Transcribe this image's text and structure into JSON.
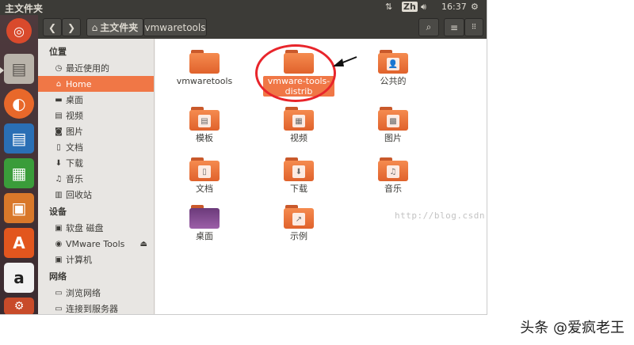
{
  "window_title": "主文件夹",
  "top_panel": {
    "ime": "Zh",
    "time": "16:37"
  },
  "toolbar": {
    "home_crumb": "主文件夹",
    "crumb_2": "vmwaretools"
  },
  "sidebar": {
    "places_header": "位置",
    "places": [
      {
        "label": "最近使用的",
        "icon": "clock-icon",
        "glyph": "◷"
      },
      {
        "label": "Home",
        "icon": "home-icon",
        "glyph": "⌂",
        "active": true
      },
      {
        "label": "桌面",
        "icon": "desktop-icon",
        "glyph": "▬"
      },
      {
        "label": "视频",
        "icon": "video-icon",
        "glyph": "▤"
      },
      {
        "label": "图片",
        "icon": "camera-icon",
        "glyph": "◙"
      },
      {
        "label": "文档",
        "icon": "document-icon",
        "glyph": "▯"
      },
      {
        "label": "下载",
        "icon": "download-icon",
        "glyph": "⬇"
      },
      {
        "label": "音乐",
        "icon": "music-icon",
        "glyph": "♫"
      },
      {
        "label": "回收站",
        "icon": "trash-icon",
        "glyph": "▥"
      }
    ],
    "devices_header": "设备",
    "devices": [
      {
        "label": "软盘 磁盘",
        "icon": "floppy-icon",
        "glyph": "▣"
      },
      {
        "label": "VMware Tools",
        "icon": "disc-icon",
        "glyph": "◉",
        "eject": true
      },
      {
        "label": "计算机",
        "icon": "computer-icon",
        "glyph": "▣"
      }
    ],
    "network_header": "网络",
    "network": [
      {
        "label": "浏览网络",
        "icon": "network-icon",
        "glyph": "▭"
      },
      {
        "label": "连接到服务器",
        "icon": "server-icon",
        "glyph": "▭"
      }
    ]
  },
  "files": [
    {
      "name": "vmwaretools",
      "emblem": "",
      "icon": "folder-icon"
    },
    {
      "name": "vmware-tools-distrib",
      "emblem": "",
      "icon": "folder-icon",
      "selected": true
    },
    {
      "name": "公共的",
      "emblem": "👤",
      "icon": "public-folder-icon"
    },
    {
      "name": "模板",
      "emblem": "▤",
      "icon": "templates-folder-icon"
    },
    {
      "name": "视频",
      "emblem": "▦",
      "icon": "videos-folder-icon"
    },
    {
      "name": "图片",
      "emblem": "▩",
      "icon": "pictures-folder-icon"
    },
    {
      "name": "文档",
      "emblem": "▯",
      "icon": "documents-folder-icon"
    },
    {
      "name": "下载",
      "emblem": "⬇",
      "icon": "downloads-folder-icon"
    },
    {
      "name": "音乐",
      "emblem": "♫",
      "icon": "music-folder-icon"
    },
    {
      "name": "桌面",
      "emblem": "",
      "icon": "desktop-folder-icon"
    },
    {
      "name": "示例",
      "emblem": "↗",
      "icon": "examples-folder-icon"
    }
  ],
  "watermark": "http://blog.csdn.net/z",
  "caption": "头条 @爱疯老王",
  "colors": {
    "accent": "#f07746",
    "panel": "#3c3b37",
    "annotation": "#e8252b"
  }
}
